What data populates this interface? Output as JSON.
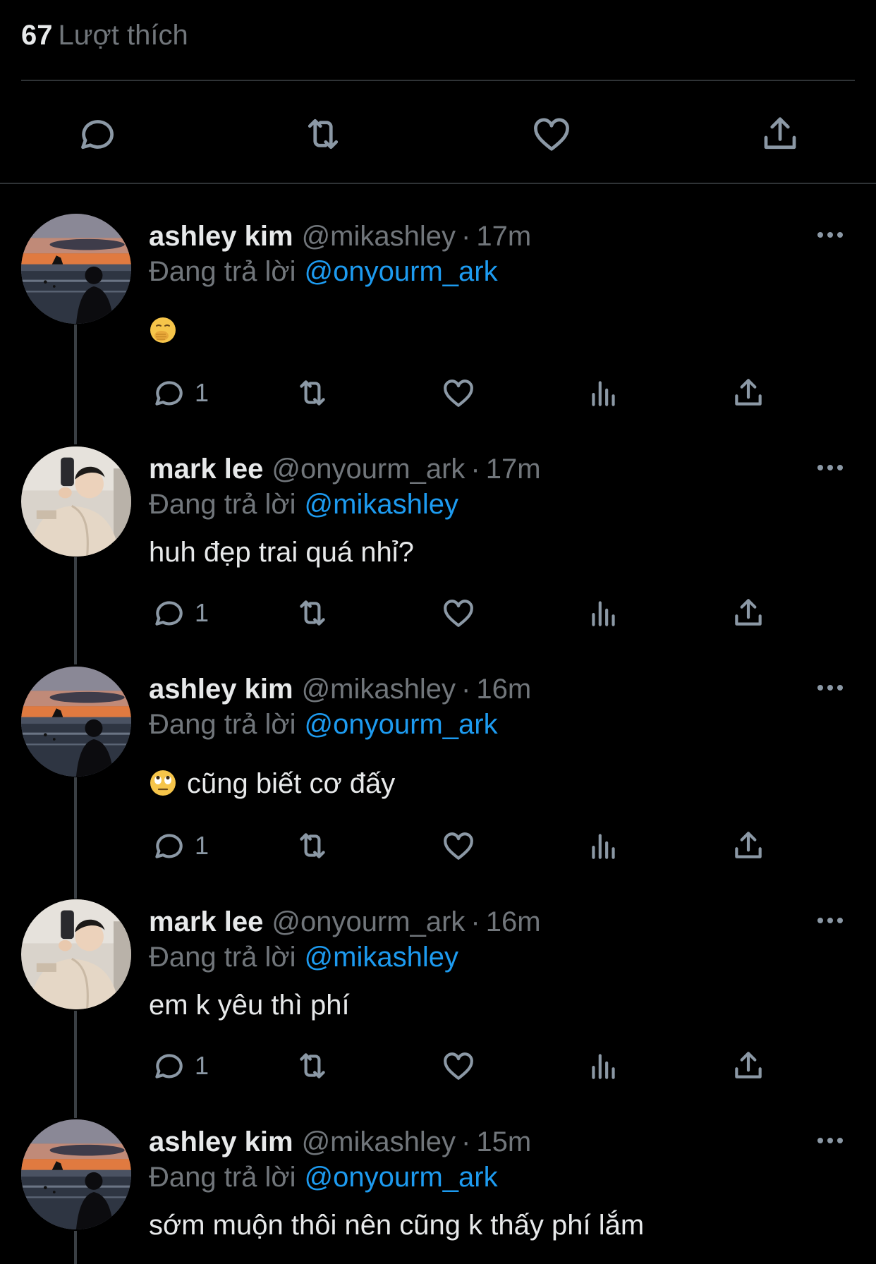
{
  "tweet": {
    "likes_count": "67",
    "likes_label": "Lượt thích"
  },
  "replies": [
    {
      "name": "ashley kim",
      "handle": "@mikashley",
      "dot": "·",
      "time": "17m",
      "replying_prefix": "Đang trả lời",
      "replying_to": "@onyourm_ark",
      "emoji": "hand-over-mouth-emoji",
      "text": "",
      "reply_count": "1",
      "avatar": "sunset-beach-avatar"
    },
    {
      "name": "mark lee",
      "handle": "@onyourm_ark",
      "dot": "·",
      "time": "17m",
      "replying_prefix": "Đang trả lời",
      "replying_to": "@mikashley",
      "text": "huh đẹp trai quá nhỉ?",
      "reply_count": "1",
      "avatar": "mirror-selfie-avatar"
    },
    {
      "name": "ashley kim",
      "handle": "@mikashley",
      "dot": "·",
      "time": "16m",
      "replying_prefix": "Đang trả lời",
      "replying_to": "@onyourm_ark",
      "emoji": "eye-roll-emoji",
      "text": "cũng biết cơ đấy",
      "reply_count": "1",
      "avatar": "sunset-beach-avatar"
    },
    {
      "name": "mark lee",
      "handle": "@onyourm_ark",
      "dot": "·",
      "time": "16m",
      "replying_prefix": "Đang trả lời",
      "replying_to": "@mikashley",
      "text": "em k yêu thì phí",
      "reply_count": "1",
      "avatar": "mirror-selfie-avatar"
    },
    {
      "name": "ashley kim",
      "handle": "@mikashley",
      "dot": "·",
      "time": "15m",
      "replying_prefix": "Đang trả lời",
      "replying_to": "@onyourm_ark",
      "text": "sớm muộn thôi nên cũng k thấy phí lắm",
      "avatar": "sunset-beach-avatar"
    }
  ],
  "colors": {
    "background": "#000000",
    "text": "#e7e9ea",
    "secondary": "#71767b",
    "accent": "#1d9bf0",
    "icon": "#8b98a5",
    "divider": "#2f3336"
  }
}
